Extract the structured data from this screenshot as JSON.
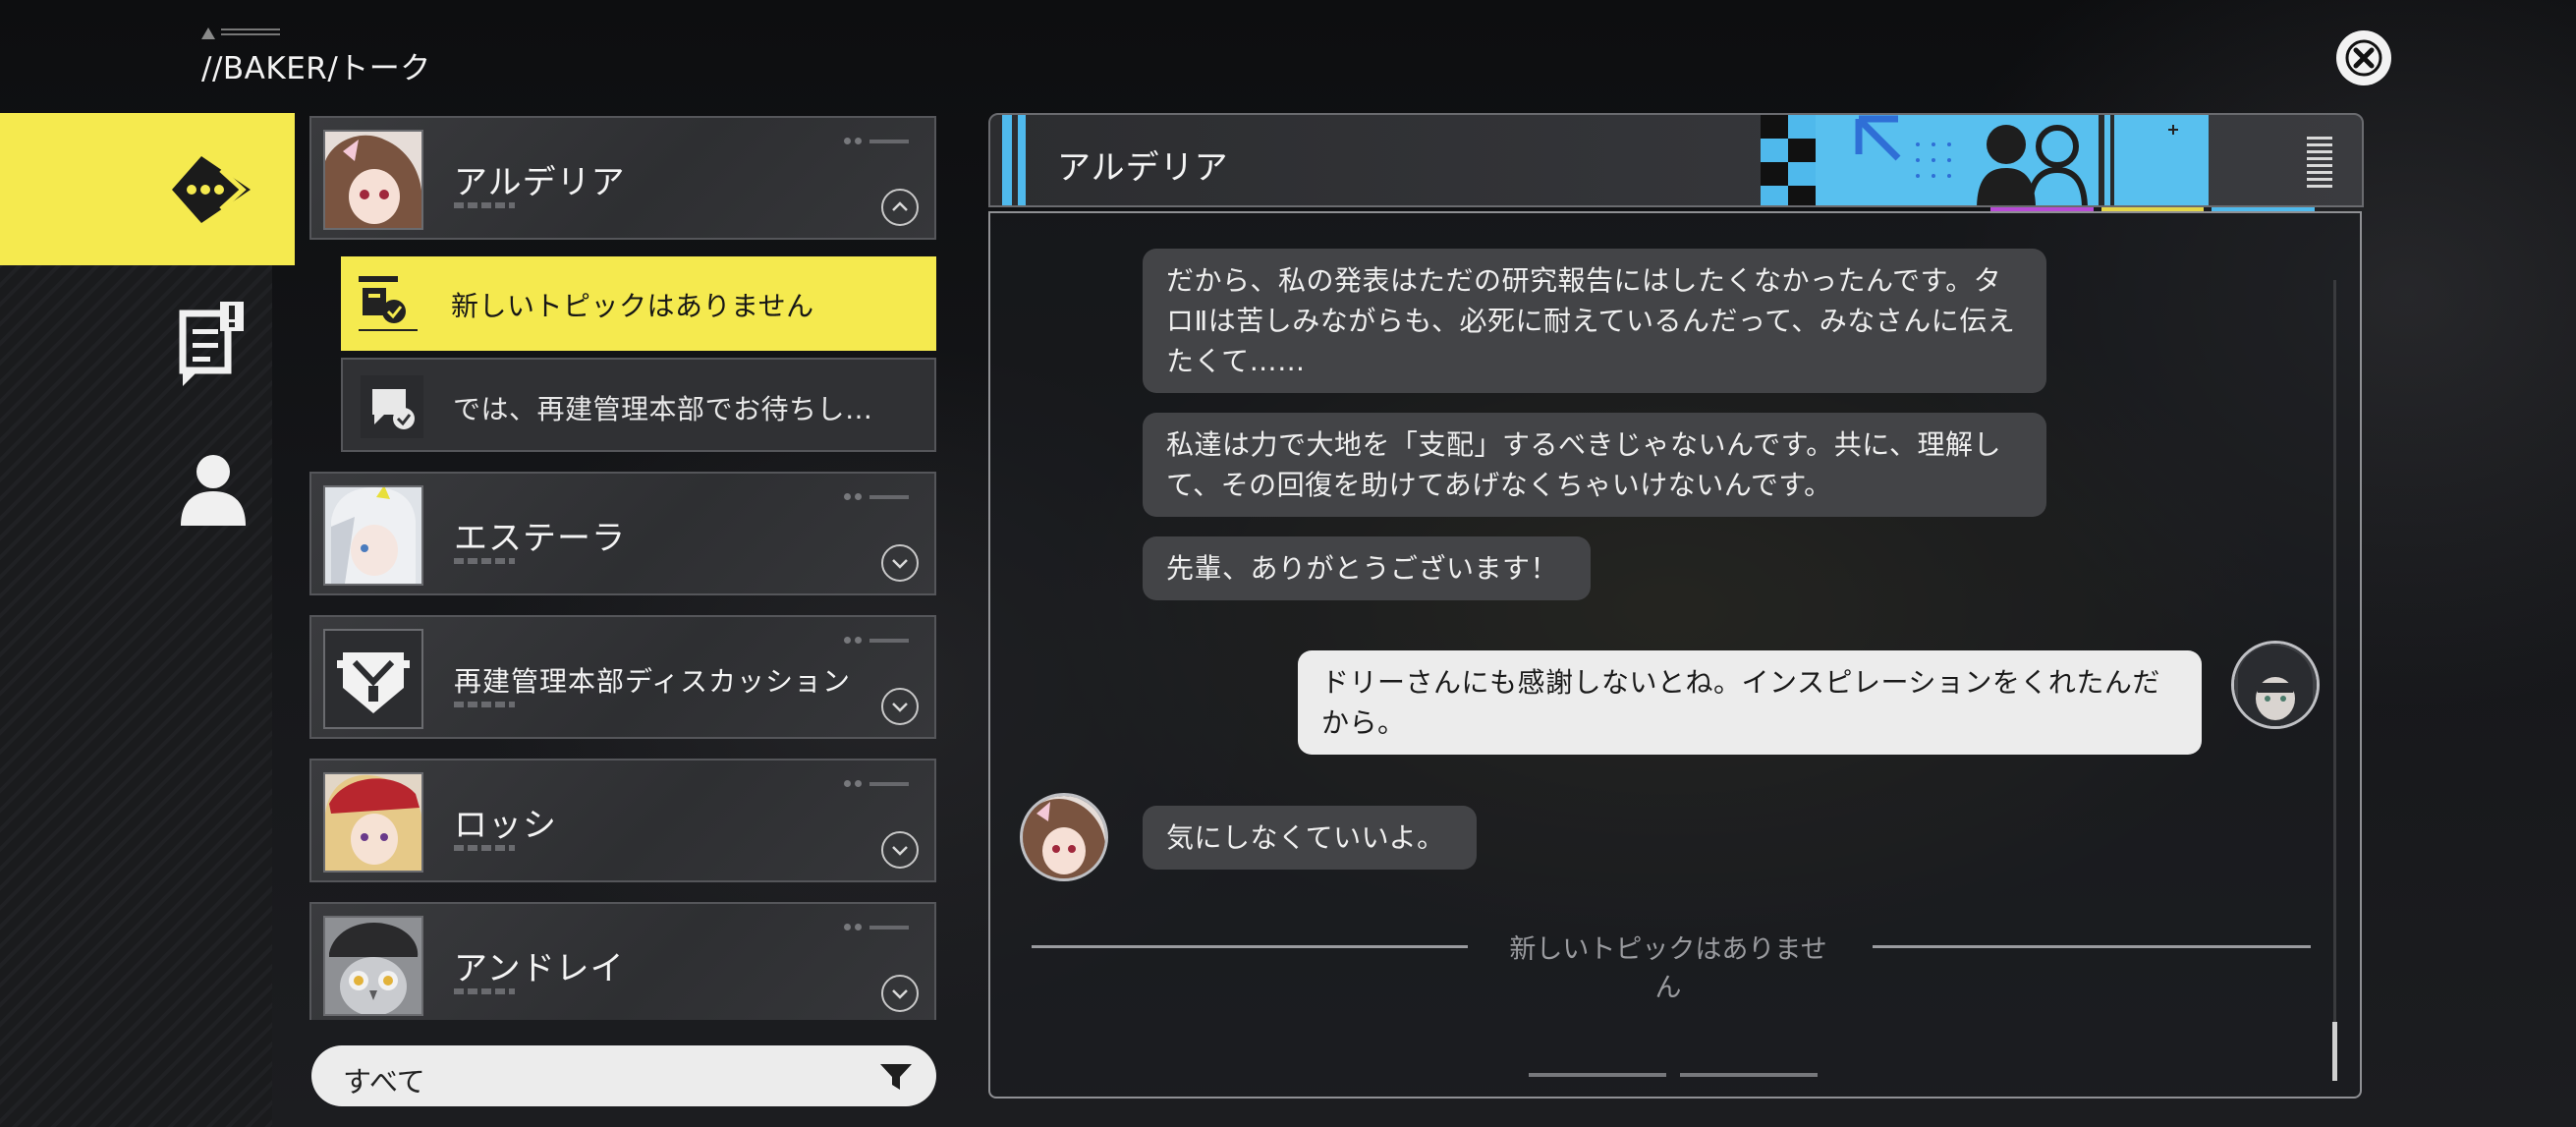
{
  "header": {
    "title": "//BAKER/トーク"
  },
  "colors": {
    "accent_yellow": "#f5ea4f",
    "accent_blue": "#4fb9ec",
    "bubble_in": "#434447",
    "bubble_out": "#ececec"
  },
  "rail": {
    "tabs": [
      {
        "icon": "talk-icon",
        "active": true
      },
      {
        "icon": "report-icon",
        "active": false
      },
      {
        "icon": "profile-icon",
        "active": false
      }
    ]
  },
  "contacts": {
    "items": [
      {
        "name": "アルデリア",
        "expanded": true
      },
      {
        "name": "エステーラ",
        "expanded": false
      },
      {
        "name": "再建管理本部ディスカッション",
        "expanded": false
      },
      {
        "name": "ロッシ",
        "expanded": false
      },
      {
        "name": "アンドレイ",
        "expanded": false
      }
    ],
    "topics": [
      {
        "label": "新しいトピックはありません",
        "active": true
      },
      {
        "label": "では、再建管理本部でお待ちし…",
        "active": false
      }
    ]
  },
  "filter": {
    "label": "すべて"
  },
  "chat": {
    "contact_name": "アルデリア",
    "messages": [
      {
        "side": "in",
        "text": "だから、私の発表はただの研究報告にはしたくなかったんです。タロⅡは苦しみながらも、必死に耐えているんだって、みなさんに伝えたくて……"
      },
      {
        "side": "in",
        "text": "私達は力で大地を「支配」するべきじゃないんです。共に、理解して、その回復を助けてあげなくちゃいけないんです。"
      },
      {
        "side": "in",
        "text": "先輩、ありがとうございます！"
      },
      {
        "side": "out",
        "text": "ドリーさんにも感謝しないとね。インスピレーションをくれたんだから。"
      },
      {
        "side": "in",
        "text": "気にしなくていいよ。"
      }
    ],
    "end_divider": "新しいトピックはありません"
  }
}
